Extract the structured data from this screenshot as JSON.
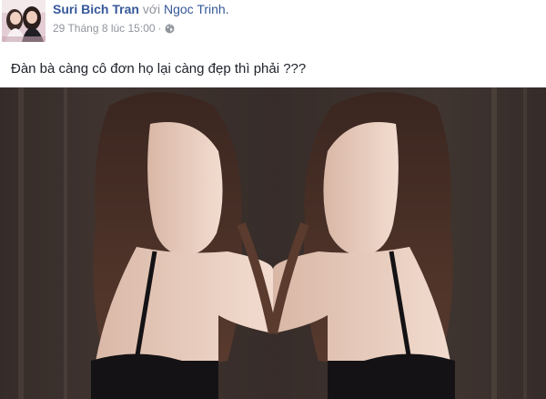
{
  "post": {
    "author": "Suri Bich Tran",
    "with_word": "với",
    "tagged_friend": "Ngoc Trinh.",
    "timestamp": "29 Tháng 8 lúc 15:00",
    "separator": "·",
    "privacy_icon": "globe-icon",
    "text": "Đàn bà càng cô đơn họ lại càng đẹp thì phải ???"
  },
  "colors": {
    "link": "#365899",
    "meta": "#90949c",
    "text": "#1d2129"
  }
}
